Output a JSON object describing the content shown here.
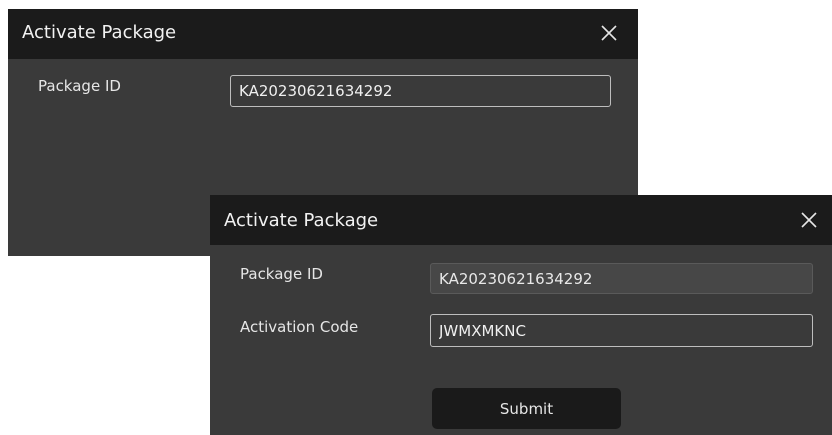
{
  "back_dialog": {
    "title": "Activate Package",
    "package_id_label": "Package ID",
    "package_id_value": "KA20230621634292"
  },
  "front_dialog": {
    "title": "Activate Package",
    "package_id_label": "Package ID",
    "package_id_value": "KA20230621634292",
    "activation_code_label": "Activation Code",
    "activation_code_value": "JWMXMKNC",
    "submit_label": "Submit"
  },
  "icons": {
    "close": "close-icon"
  },
  "colors": {
    "dialog_bg": "#3a3a3a",
    "titlebar_bg": "#1b1b1b",
    "button_bg": "#1a1a1a",
    "text": "#e6e6e6"
  }
}
